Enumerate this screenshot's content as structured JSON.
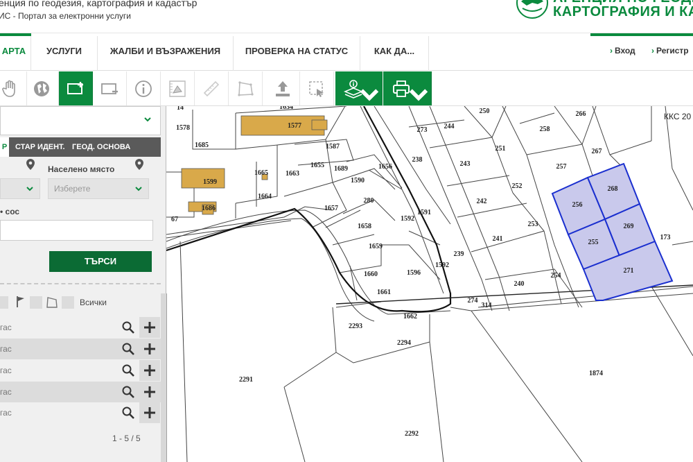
{
  "header": {
    "agency_line1": "енция по геодезия, картография и кадастър",
    "agency_line2": "ИС - Портал за електронни услуги",
    "logo_line1": "АГЕНЦИЯ ПО ГЕОДЕЗ",
    "logo_line2": "КАРТОГРАФИЯ И КАД",
    "logo_icon": "globe-logo-icon"
  },
  "nav": {
    "items": [
      "АРТА",
      "УСЛУГИ",
      "ЖАЛБИ И ВЪЗРАЖЕНИЯ",
      "ПРОВЕРКА НА СТАТУС",
      "КАК ДА..."
    ],
    "login": "Вход",
    "register": "Регистр"
  },
  "toolbar": {
    "tools": [
      "hand-pan-icon",
      "globe-icon",
      "select-add-icon",
      "select-remove-icon",
      "info-icon",
      "measure-area-icon",
      "ruler-icon",
      "polygon-icon",
      "upload-icon",
      "select-rect-icon",
      "layers-info-icon",
      "print-icon"
    ]
  },
  "sidebar": {
    "tabs": [
      "Р",
      "СТАР ИДЕНТ.",
      "ГЕОД. ОСНОВА"
    ],
    "settlement_label": "Населено място",
    "settlement_placeholder": "Изберете",
    "field_label": "• сос",
    "search_button": "ТЪРСИ",
    "filter_all": "Всички",
    "results": [
      "гас",
      "гас",
      "гас",
      "гас",
      "гас"
    ],
    "pagination": "1 - 5 / 5"
  },
  "map": {
    "kks_label": "ККС 20",
    "parcels": [
      "1578",
      "1634",
      "1577",
      "1587",
      "1685",
      "1655",
      "1689",
      "1656",
      "1665",
      "1663",
      "1599",
      "1590",
      "1664",
      "1686",
      "1657",
      "280",
      "1591",
      "1592",
      "1658",
      "1659",
      "1592",
      "239",
      "1660",
      "1596",
      "1661",
      "1662",
      "2293",
      "2294",
      "2291",
      "2292",
      "273",
      "244",
      "250",
      "238",
      "243",
      "251",
      "242",
      "252",
      "241",
      "253",
      "240",
      "254",
      "258",
      "266",
      "257",
      "267",
      "256",
      "268",
      "255",
      "269",
      "271",
      "173",
      "274",
      "314",
      "1874",
      "67",
      "14"
    ],
    "highlight_color": "#1a2fcf",
    "building_color": "#d9a94a"
  }
}
